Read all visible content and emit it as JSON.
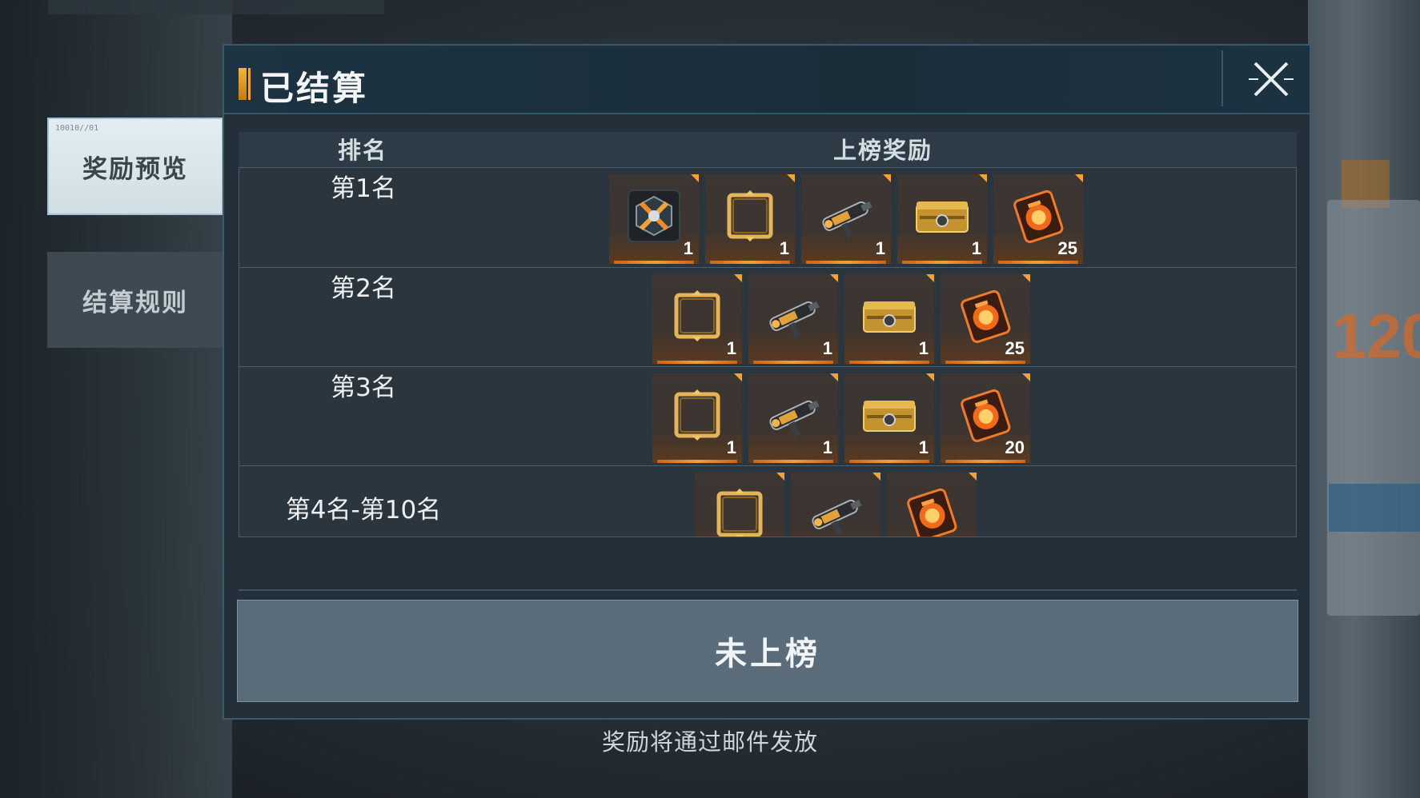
{
  "dialog": {
    "title": "已结算",
    "close_icon": "close-x-icon"
  },
  "tabs": [
    {
      "label": "奖励预览",
      "code": "10010//01",
      "active": true
    },
    {
      "label": "结算规则",
      "active": false
    }
  ],
  "table": {
    "headers": {
      "rank": "排名",
      "reward": "上榜奖励"
    },
    "rows": [
      {
        "rank": "第1名",
        "rewards": [
          {
            "icon": "king-badge-icon",
            "qty": "1"
          },
          {
            "icon": "gold-frame-icon",
            "qty": "1"
          },
          {
            "icon": "weapon-icon",
            "qty": "1"
          },
          {
            "icon": "gold-crate-icon",
            "qty": "1"
          },
          {
            "icon": "fire-card-icon",
            "qty": "25"
          }
        ]
      },
      {
        "rank": "第2名",
        "rewards": [
          {
            "icon": "gold-frame-icon",
            "qty": "1"
          },
          {
            "icon": "weapon-icon",
            "qty": "1"
          },
          {
            "icon": "gold-crate-icon",
            "qty": "1"
          },
          {
            "icon": "fire-card-icon",
            "qty": "25"
          }
        ]
      },
      {
        "rank": "第3名",
        "rewards": [
          {
            "icon": "gold-frame-icon",
            "qty": "1"
          },
          {
            "icon": "weapon-icon",
            "qty": "1"
          },
          {
            "icon": "gold-crate-icon",
            "qty": "1"
          },
          {
            "icon": "fire-card-icon",
            "qty": "20"
          }
        ]
      },
      {
        "rank": "第4名-第10名",
        "rewards": [
          {
            "icon": "gold-frame-icon"
          },
          {
            "icon": "weapon-icon"
          },
          {
            "icon": "fire-card-icon"
          }
        ]
      }
    ]
  },
  "not_ranked_label": "未上榜",
  "footer_note": "奖励将通过邮件发放",
  "background": {
    "right_number": "120"
  }
}
